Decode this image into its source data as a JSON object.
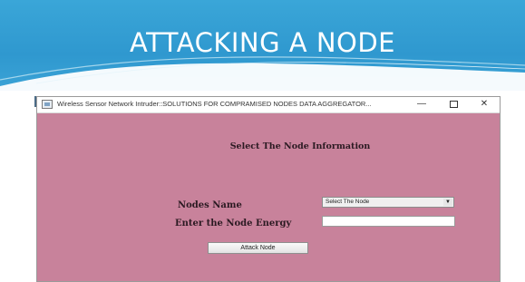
{
  "slide": {
    "title": "ATTACKING A NODE"
  },
  "window": {
    "title": "Wireless Sensor Network Intruder::SOLUTIONS FOR COMPRAMISED NODES DATA AGGREGATOR...",
    "minimize_glyph": "—",
    "close_glyph": "✕"
  },
  "form": {
    "heading": "Select The Node Information",
    "nodes_name_label": "Nodes Name",
    "node_select_value": "Select The Node",
    "energy_label": "Enter the Node Energy",
    "energy_value": "",
    "attack_button_label": "Attack Node"
  },
  "colors": {
    "header_blue": "#2f98cf",
    "window_bg": "#c8829b"
  }
}
